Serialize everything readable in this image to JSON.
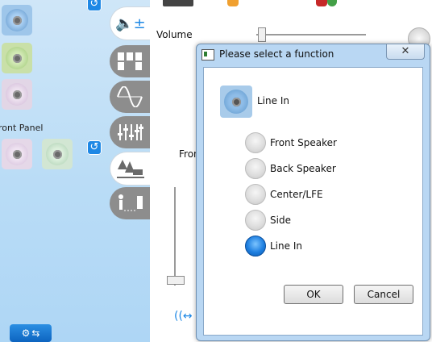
{
  "left_panel": {
    "front_panel_label": "ront Panel"
  },
  "main": {
    "volume_label": "Volume",
    "fron_label": "Fron"
  },
  "dialog": {
    "title": "Please select a function",
    "close_label": "✕",
    "current_function": "Line In",
    "options": [
      {
        "label": "Front Speaker",
        "checked": false
      },
      {
        "label": "Back Speaker",
        "checked": false
      },
      {
        "label": "Center/LFE",
        "checked": false
      },
      {
        "label": "Side",
        "checked": false
      },
      {
        "label": "Line In",
        "checked": true
      }
    ],
    "ok_label": "OK",
    "cancel_label": "Cancel"
  }
}
